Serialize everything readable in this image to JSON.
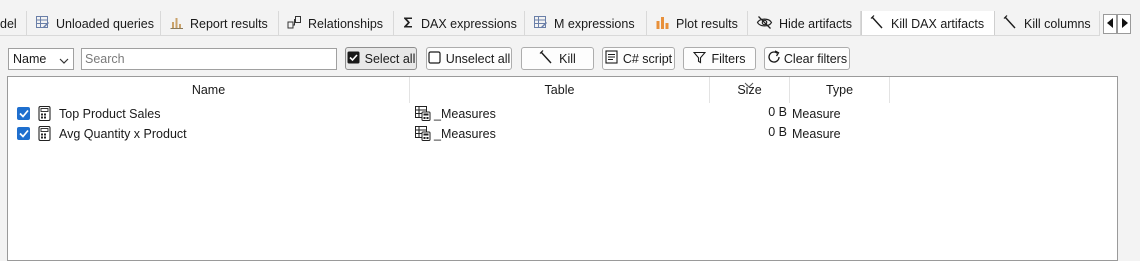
{
  "tabs": [
    {
      "label": "del",
      "icon": "none",
      "active": false
    },
    {
      "label": "Unloaded queries",
      "icon": "grid-edit-icon",
      "active": false
    },
    {
      "label": "Report results",
      "icon": "bar-chart-icon",
      "active": false
    },
    {
      "label": "Relationships",
      "icon": "relationships-icon",
      "active": false
    },
    {
      "label": "DAX expressions",
      "icon": "sigma-icon",
      "active": false
    },
    {
      "label": "M expressions",
      "icon": "grid-edit-icon",
      "active": false
    },
    {
      "label": "Plot results",
      "icon": "plot-chart-icon",
      "active": false
    },
    {
      "label": "Hide artifacts",
      "icon": "eye-off-icon",
      "active": false
    },
    {
      "label": "Kill DAX artifacts",
      "icon": "kill-icon",
      "active": true
    },
    {
      "label": "Kill columns",
      "icon": "kill-icon",
      "active": false
    }
  ],
  "toolbar": {
    "field_select": "Name",
    "search_placeholder": "Search",
    "select_all": "Select all",
    "unselect_all": "Unselect all",
    "kill": "Kill",
    "csharp_script": "C# script",
    "filters": "Filters",
    "clear_filters": "Clear filters"
  },
  "grid": {
    "columns": [
      "Name",
      "Table",
      "Size",
      "Type"
    ],
    "rows": [
      {
        "checked": true,
        "name": "Top Product Sales",
        "table": "_Measures",
        "size": "0 B",
        "type": "Measure"
      },
      {
        "checked": true,
        "name": "Avg Quantity x Product",
        "table": "_Measures",
        "size": "0 B",
        "type": "Measure"
      }
    ]
  },
  "colors": {
    "accent": "#1f6fce",
    "chart_orange": "#e8903a"
  }
}
